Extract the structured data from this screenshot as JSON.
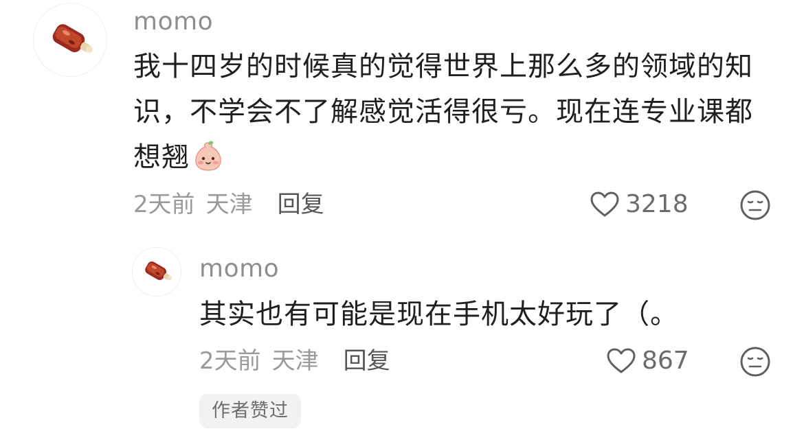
{
  "comment": {
    "username": "momo",
    "lines": [
      "我十四岁的时候真的觉得世界上那么多的领域的知",
      "识，不学会不了解感觉活得很亏。现在连专业课都",
      "想翘"
    ],
    "emoji": "shy-face-emoji",
    "time": "2天前",
    "location": "天津",
    "reply_label": "回复",
    "likes": "3218"
  },
  "reply": {
    "username": "momo",
    "text": "其实也有可能是现在手机太好玩了（。",
    "time": "2天前",
    "location": "天津",
    "reply_label": "回复",
    "likes": "867",
    "badge": "作者赞过"
  },
  "icons": {
    "avatar": "rib-food-icon",
    "like": "heart-outline-icon",
    "dislike": "expressionless-face-icon"
  }
}
